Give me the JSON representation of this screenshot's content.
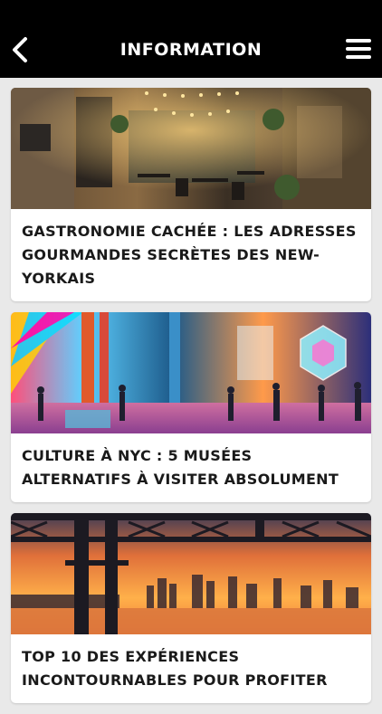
{
  "header": {
    "title": "INFORMATION",
    "back_icon": "chevron-left-icon",
    "menu_icon": "hamburger-menu-icon"
  },
  "articles": [
    {
      "title": "GASTRONOMIE CACHÉE : LES ADRESSES GOURMANDES SECRÈTES DES NEW-YORKAIS"
    },
    {
      "title": "CULTURE À NYC : 5 MUSÉES ALTERNATIFS À VISITER ABSOLUMENT"
    },
    {
      "title": "TOP 10 DES EXPÉRIENCES INCONTOURNABLES POUR PROFITER"
    }
  ],
  "colors": {
    "header_bg": "#000000",
    "page_bg": "#e9e9e9",
    "card_bg": "#ffffff",
    "title_text": "#1a1a1a"
  }
}
